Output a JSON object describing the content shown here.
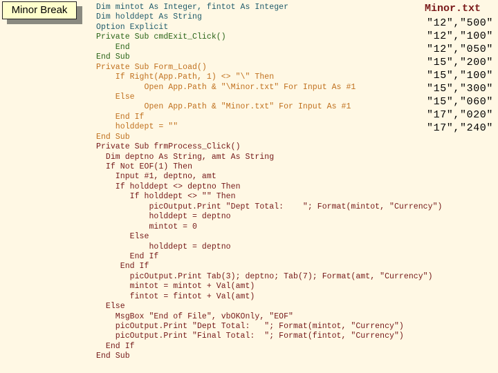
{
  "slide": {
    "title": "Minor Break"
  },
  "code": {
    "lines": [
      {
        "text": "Dim mintot As Integer, fintot As Integer",
        "color": "teal"
      },
      {
        "text": "Dim holddept As String",
        "color": "teal"
      },
      {
        "text": "Option Explicit",
        "color": "teal"
      },
      {
        "text": "Private Sub cmdExit_Click()",
        "color": "green"
      },
      {
        "text": "    End",
        "color": "green"
      },
      {
        "text": "End Sub",
        "color": "green"
      },
      {
        "text": "Private Sub Form_Load()",
        "color": "orange"
      },
      {
        "text": "    If Right(App.Path, 1) <> \"\\\" Then",
        "color": "orange"
      },
      {
        "text": "          Open App.Path & \"\\Minor.txt\" For Input As #1",
        "color": "orange"
      },
      {
        "text": "    Else",
        "color": "orange"
      },
      {
        "text": "          Open App.Path & \"Minor.txt\" For Input As #1",
        "color": "orange"
      },
      {
        "text": "    End If",
        "color": "orange"
      },
      {
        "text": "    holddept = \"\"",
        "color": "orange"
      },
      {
        "text": "End Sub",
        "color": "orange"
      },
      {
        "text": "Private Sub frmProcess_Click()",
        "color": "maroon"
      },
      {
        "text": "  Dim deptno As String, amt As String",
        "color": "maroon"
      },
      {
        "text": "  If Not EOF(1) Then",
        "color": "maroon"
      },
      {
        "text": "    Input #1, deptno, amt",
        "color": "maroon"
      },
      {
        "text": "    If holddept <> deptno Then",
        "color": "maroon"
      },
      {
        "text": "       If holddept <> \"\" Then",
        "color": "maroon"
      },
      {
        "text": "           picOutput.Print \"Dept Total:    \"; Format(mintot, \"Currency\")",
        "color": "maroon"
      },
      {
        "text": "           holddept = deptno",
        "color": "maroon"
      },
      {
        "text": "           mintot = 0",
        "color": "maroon"
      },
      {
        "text": "       Else",
        "color": "maroon"
      },
      {
        "text": "           holddept = deptno",
        "color": "maroon"
      },
      {
        "text": "       End If",
        "color": "maroon"
      },
      {
        "text": "     End If",
        "color": "maroon"
      },
      {
        "text": "       picOutput.Print Tab(3); deptno; Tab(7); Format(amt, \"Currency\")",
        "color": "maroon"
      },
      {
        "text": "       mintot = mintot + Val(amt)",
        "color": "maroon"
      },
      {
        "text": "       fintot = fintot + Val(amt)",
        "color": "maroon"
      },
      {
        "text": "  Else",
        "color": "maroon"
      },
      {
        "text": "    MsgBox \"End of File\", vbOKOnly, \"EOF\"",
        "color": "maroon"
      },
      {
        "text": "    picOutput.Print \"Dept Total:   \"; Format(mintot, \"Currency\")",
        "color": "maroon"
      },
      {
        "text": "    picOutput.Print \"Final Total:  \"; Format(fintot, \"Currency\")",
        "color": "maroon"
      },
      {
        "text": "  End If",
        "color": "maroon"
      },
      {
        "text": "End Sub",
        "color": "maroon"
      }
    ]
  },
  "file": {
    "title": "Minor.txt",
    "lines": [
      "\"12\",\"500\"",
      "\"12\",\"100\"",
      "\"12\",\"050\"",
      "\"15\",\"200\"",
      "\"15\",\"100\"",
      "\"15\",\"300\"",
      "\"15\",\"060\"",
      "\"17\",\"020\"",
      "\"17\",\"240\""
    ]
  },
  "colors": {
    "background": "#fff8e4",
    "title_box": "#ffffcc",
    "teal": "#1e5a6a",
    "green": "#2a6418",
    "orange": "#c0701e",
    "maroon": "#741818",
    "file_title": "#7a1a1a"
  }
}
